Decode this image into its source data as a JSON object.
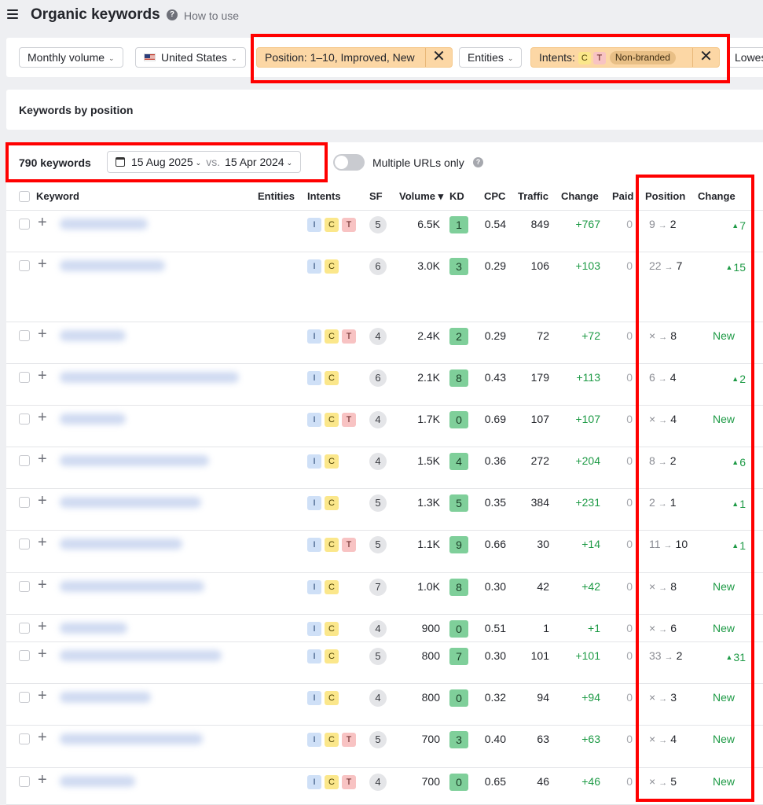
{
  "header": {
    "title": "Organic keywords",
    "help_link": "How to use"
  },
  "filters": {
    "volume": "Monthly volume",
    "country": "United States",
    "position_chip": "Position: 1–10, Improved, New",
    "entities": "Entities",
    "intents_label": "Intents:",
    "intents_c": "C",
    "intents_t": "T",
    "intents_nonbranded": "Non-branded",
    "close_symbol": "✕",
    "lowest": "Lowest"
  },
  "section": {
    "title": "Keywords by position"
  },
  "toolbar": {
    "count": "790 keywords",
    "date_current": "15 Aug 2025",
    "vs": "vs.",
    "date_compare": "15 Apr 2024",
    "multiple_urls": "Multiple URLs only",
    "help_q": "?"
  },
  "table": {
    "headers": {
      "keyword": "Keyword",
      "entities": "Entities",
      "intents": "Intents",
      "sf": "SF",
      "volume": "Volume ▾",
      "kd": "KD",
      "cpc": "CPC",
      "traffic": "Traffic",
      "change": "Change",
      "paid": "Paid",
      "position": "Position",
      "pos_change": "Change"
    },
    "arrow": "→",
    "rows": [
      {
        "intents": [
          "I",
          "C",
          "T"
        ],
        "sf": "5",
        "volume": "6.5K",
        "kd": "1",
        "cpc": "0.54",
        "traffic": "849",
        "change": "+767",
        "paid": "0",
        "pos_from": "9",
        "pos_to": "2",
        "pos_change": "7",
        "is_new": false
      },
      {
        "intents": [
          "I",
          "C"
        ],
        "sf": "6",
        "volume": "3.0K",
        "kd": "3",
        "cpc": "0.29",
        "traffic": "106",
        "change": "+103",
        "paid": "0",
        "pos_from": "22",
        "pos_to": "7",
        "pos_change": "15",
        "is_new": false
      },
      {
        "intents": [
          "I",
          "C",
          "T"
        ],
        "sf": "4",
        "volume": "2.4K",
        "kd": "2",
        "cpc": "0.29",
        "traffic": "72",
        "change": "+72",
        "paid": "0",
        "pos_from": "×",
        "pos_to": "8",
        "pos_change": "New",
        "is_new": true
      },
      {
        "intents": [
          "I",
          "C"
        ],
        "sf": "6",
        "volume": "2.1K",
        "kd": "8",
        "cpc": "0.43",
        "traffic": "179",
        "change": "+113",
        "paid": "0",
        "pos_from": "6",
        "pos_to": "4",
        "pos_change": "2",
        "is_new": false
      },
      {
        "intents": [
          "I",
          "C",
          "T"
        ],
        "sf": "4",
        "volume": "1.7K",
        "kd": "0",
        "cpc": "0.69",
        "traffic": "107",
        "change": "+107",
        "paid": "0",
        "pos_from": "×",
        "pos_to": "4",
        "pos_change": "New",
        "is_new": true
      },
      {
        "intents": [
          "I",
          "C"
        ],
        "sf": "4",
        "volume": "1.5K",
        "kd": "4",
        "cpc": "0.36",
        "traffic": "272",
        "change": "+204",
        "paid": "0",
        "pos_from": "8",
        "pos_to": "2",
        "pos_change": "6",
        "is_new": false
      },
      {
        "intents": [
          "I",
          "C"
        ],
        "sf": "5",
        "volume": "1.3K",
        "kd": "5",
        "cpc": "0.35",
        "traffic": "384",
        "change": "+231",
        "paid": "0",
        "pos_from": "2",
        "pos_to": "1",
        "pos_change": "1",
        "is_new": false
      },
      {
        "intents": [
          "I",
          "C",
          "T"
        ],
        "sf": "5",
        "volume": "1.1K",
        "kd": "9",
        "cpc": "0.66",
        "traffic": "30",
        "change": "+14",
        "paid": "0",
        "pos_from": "11",
        "pos_to": "10",
        "pos_change": "1",
        "is_new": false
      },
      {
        "intents": [
          "I",
          "C"
        ],
        "sf": "7",
        "volume": "1.0K",
        "kd": "8",
        "cpc": "0.30",
        "traffic": "42",
        "change": "+42",
        "paid": "0",
        "pos_from": "×",
        "pos_to": "8",
        "pos_change": "New",
        "is_new": true
      },
      {
        "intents": [
          "I",
          "C"
        ],
        "sf": "4",
        "volume": "900",
        "kd": "0",
        "cpc": "0.51",
        "traffic": "1",
        "change": "+1",
        "paid": "0",
        "pos_from": "×",
        "pos_to": "6",
        "pos_change": "New",
        "is_new": true
      },
      {
        "intents": [
          "I",
          "C"
        ],
        "sf": "5",
        "volume": "800",
        "kd": "7",
        "cpc": "0.30",
        "traffic": "101",
        "change": "+101",
        "paid": "0",
        "pos_from": "33",
        "pos_to": "2",
        "pos_change": "31",
        "is_new": false
      },
      {
        "intents": [
          "I",
          "C"
        ],
        "sf": "4",
        "volume": "800",
        "kd": "0",
        "cpc": "0.32",
        "traffic": "94",
        "change": "+94",
        "paid": "0",
        "pos_from": "×",
        "pos_to": "3",
        "pos_change": "New",
        "is_new": true
      },
      {
        "intents": [
          "I",
          "C",
          "T"
        ],
        "sf": "5",
        "volume": "700",
        "kd": "3",
        "cpc": "0.40",
        "traffic": "63",
        "change": "+63",
        "paid": "0",
        "pos_from": "×",
        "pos_to": "4",
        "pos_change": "New",
        "is_new": true
      },
      {
        "intents": [
          "I",
          "C",
          "T"
        ],
        "sf": "4",
        "volume": "700",
        "kd": "0",
        "cpc": "0.65",
        "traffic": "46",
        "change": "+46",
        "paid": "0",
        "pos_from": "×",
        "pos_to": "5",
        "pos_change": "New",
        "is_new": true
      }
    ]
  },
  "colors": {
    "highlight": "#ff0000",
    "chip_bg": "#fcd7a5",
    "positive": "#1d9a45",
    "kd_badge": "#7fcf9a"
  }
}
